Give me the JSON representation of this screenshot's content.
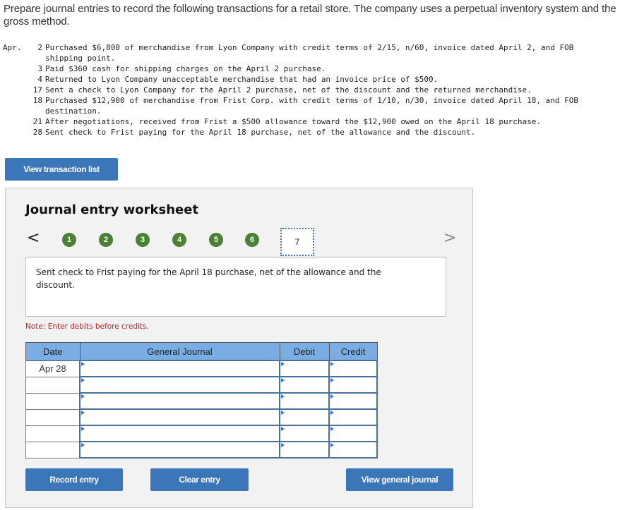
{
  "intro": "Prepare journal entries to record the following transactions for a retail store. The company uses a perpetual inventory system and the gross method.",
  "transactions": {
    "month": "Apr.",
    "items": [
      {
        "day": "2",
        "text": "Purchased $6,800 of merchandise from Lyon Company with credit terms of 2/15, n/60, invoice dated April 2, and FOB\nshipping point."
      },
      {
        "day": "3",
        "text": "Paid $360 cash for shipping charges on the April 2 purchase."
      },
      {
        "day": "4",
        "text": "Returned to Lyon Company unacceptable merchandise that had an invoice price of $500."
      },
      {
        "day": "17",
        "text": "Sent a check to Lyon Company for the April 2 purchase, net of the discount and the returned merchandise."
      },
      {
        "day": "18",
        "text": "Purchased $12,900 of merchandise from Frist Corp. with credit terms of 1/10, n/30, invoice dated April 18, and FOB\ndestination."
      },
      {
        "day": "21",
        "text": "After negotiations, received from Frist a $500 allowance toward the $12,900 owed on the April 18 purchase."
      },
      {
        "day": "28",
        "text": "Sent check to Frist paying for the April 18 purchase, net of the allowance and the discount."
      }
    ]
  },
  "buttons": {
    "view_transaction_list": "View transaction list",
    "record_entry": "Record entry",
    "clear_entry": "Clear entry",
    "view_general_journal": "View general journal"
  },
  "worksheet": {
    "title": "Journal entry worksheet",
    "nav_prev": "<",
    "nav_next": ">",
    "steps": [
      "1",
      "2",
      "3",
      "4",
      "5",
      "6"
    ],
    "current_step": "7",
    "description": "Sent check to Frist paying for the April 18 purchase, net of the allowance and the discount.",
    "note": "Note: Enter debits before credits.",
    "table": {
      "headers": {
        "date": "Date",
        "general_journal": "General Journal",
        "debit": "Debit",
        "credit": "Credit"
      },
      "rows": [
        {
          "date": "Apr 28",
          "account": "",
          "debit": "",
          "credit": ""
        },
        {
          "date": "",
          "account": "",
          "debit": "",
          "credit": ""
        },
        {
          "date": "",
          "account": "",
          "debit": "",
          "credit": ""
        },
        {
          "date": "",
          "account": "",
          "debit": "",
          "credit": ""
        },
        {
          "date": "",
          "account": "",
          "debit": "",
          "credit": ""
        },
        {
          "date": "",
          "account": "",
          "debit": "",
          "credit": ""
        }
      ]
    }
  },
  "colors": {
    "button_blue": "#3a76b8",
    "step_complete_green": "#4a8134",
    "table_header_blue": "#79ade3",
    "note_red": "#b22222"
  }
}
